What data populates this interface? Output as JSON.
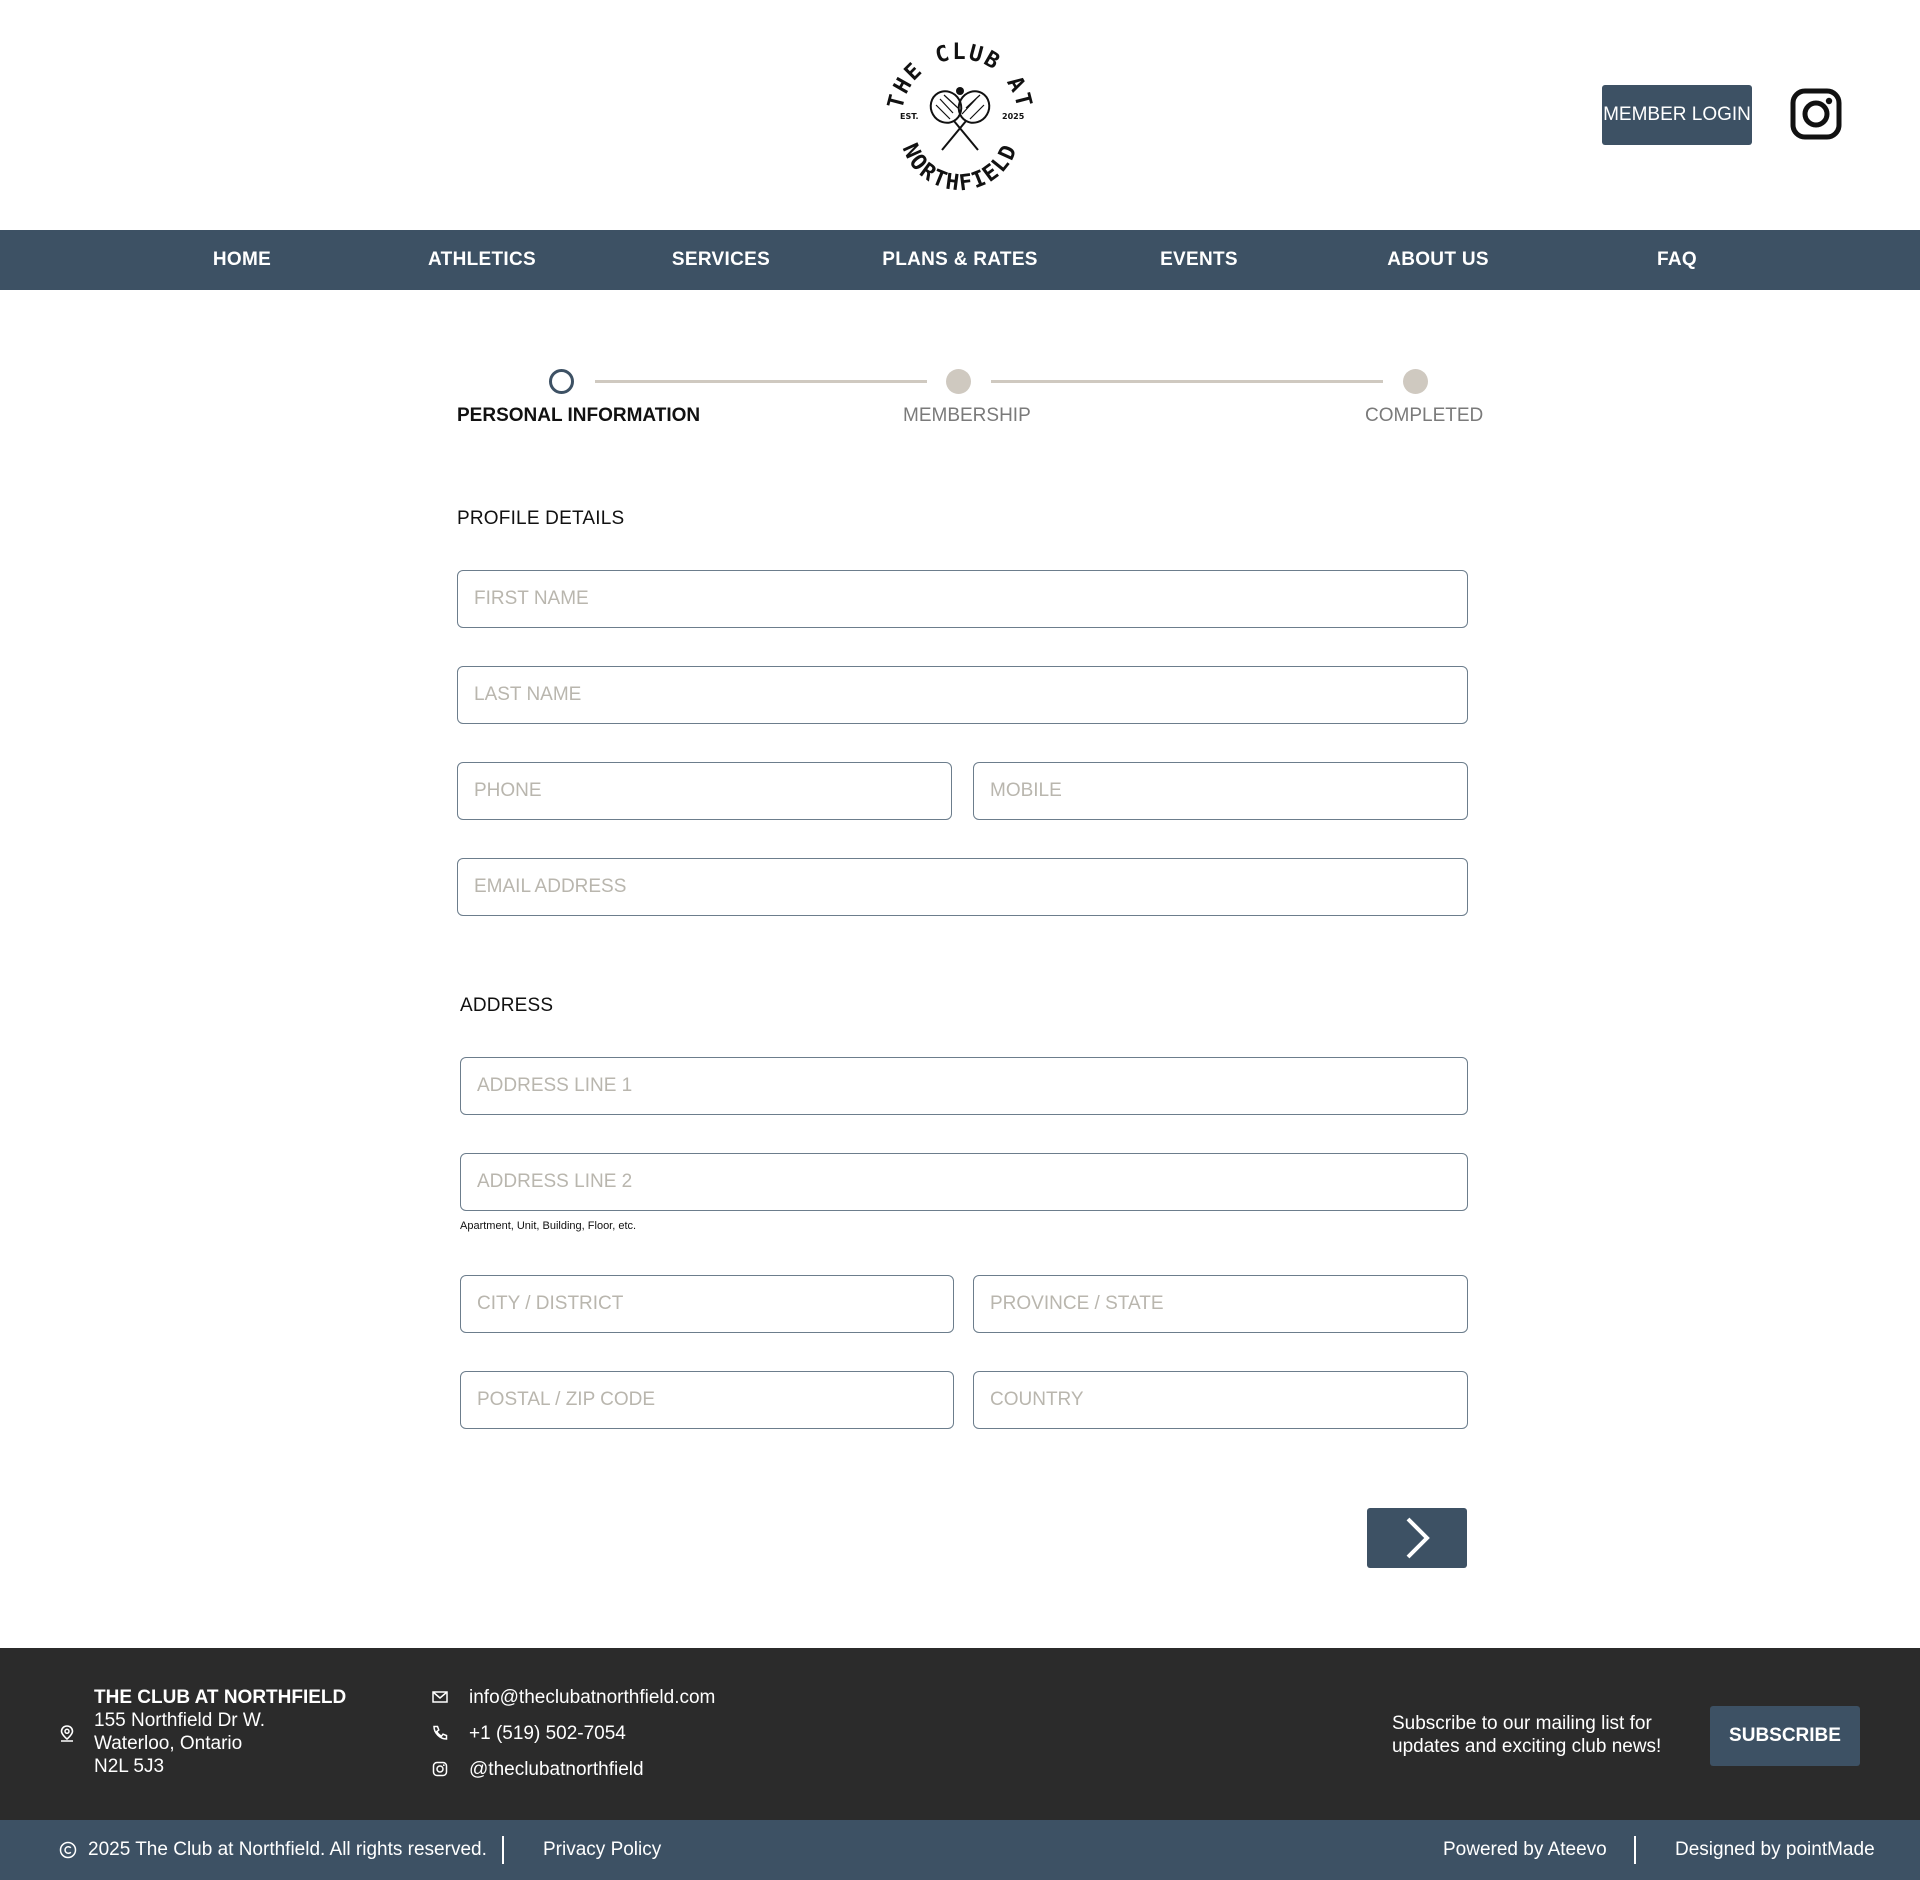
{
  "logo": {
    "top_text": "THE CLUB AT",
    "bottom_text": "NORTHFIELD",
    "est_label": "EST.",
    "year": "2025"
  },
  "header": {
    "member_login": "MEMBER LOGIN"
  },
  "nav": {
    "items": [
      "HOME",
      "ATHLETICS",
      "SERVICES",
      "PLANS & RATES",
      "EVENTS",
      "ABOUT US",
      "FAQ"
    ]
  },
  "stepper": {
    "steps": [
      {
        "label": "PERSONAL INFORMATION",
        "state": "active"
      },
      {
        "label": "MEMBERSHIP",
        "state": "pending"
      },
      {
        "label": "COMPLETED",
        "state": "pending"
      }
    ]
  },
  "profile": {
    "title": "PROFILE DETAILS",
    "first_name": {
      "placeholder": "FIRST NAME",
      "value": ""
    },
    "last_name": {
      "placeholder": "LAST NAME",
      "value": ""
    },
    "phone": {
      "placeholder": "PHONE",
      "value": ""
    },
    "mobile": {
      "placeholder": "MOBILE",
      "value": ""
    },
    "email": {
      "placeholder": "EMAIL ADDRESS",
      "value": ""
    }
  },
  "address": {
    "title": "ADDRESS",
    "line1": {
      "placeholder": "ADDRESS LINE 1",
      "value": ""
    },
    "line2": {
      "placeholder": "ADDRESS LINE 2",
      "value": ""
    },
    "line2_hint": "Apartment, Unit, Building, Floor, etc.",
    "city": {
      "placeholder": "CITY / DISTRICT",
      "value": ""
    },
    "province": {
      "placeholder": "PROVINCE / STATE",
      "value": ""
    },
    "postal": {
      "placeholder": "POSTAL / ZIP CODE",
      "value": ""
    },
    "country": {
      "placeholder": "COUNTRY",
      "value": ""
    }
  },
  "footer": {
    "club_name": "THE CLUB AT NORTHFIELD",
    "address_line1": "155 Northfield Dr W.",
    "address_line2": "Waterloo, Ontario",
    "address_line3": "N2L 5J3",
    "email": "info@theclubatnorthfield.com",
    "phone": "+1 (519) 502-7054",
    "instagram": "@theclubatnorthfield",
    "subscribe_text_1": "Subscribe to our mailing list for",
    "subscribe_text_2": "updates and exciting club news!",
    "subscribe_button": "SUBSCRIBE"
  },
  "bottom_bar": {
    "copyright": "2025 The Club at Northfield. All rights reserved.",
    "privacy": "Privacy Policy",
    "powered": "Powered by Ateevo",
    "designed": "Designed by pointMade"
  },
  "colors": {
    "primary": "#3d5164",
    "footer_bg": "#2b2b2b",
    "step_inactive": "#cfc9c0",
    "placeholder": "#b9b6ae"
  },
  "icons": {
    "instagram": "instagram-icon",
    "location": "location-pin-icon",
    "mail": "mail-icon",
    "phone": "phone-icon",
    "next": "chevron-right-icon",
    "copyright": "copyright-icon"
  }
}
